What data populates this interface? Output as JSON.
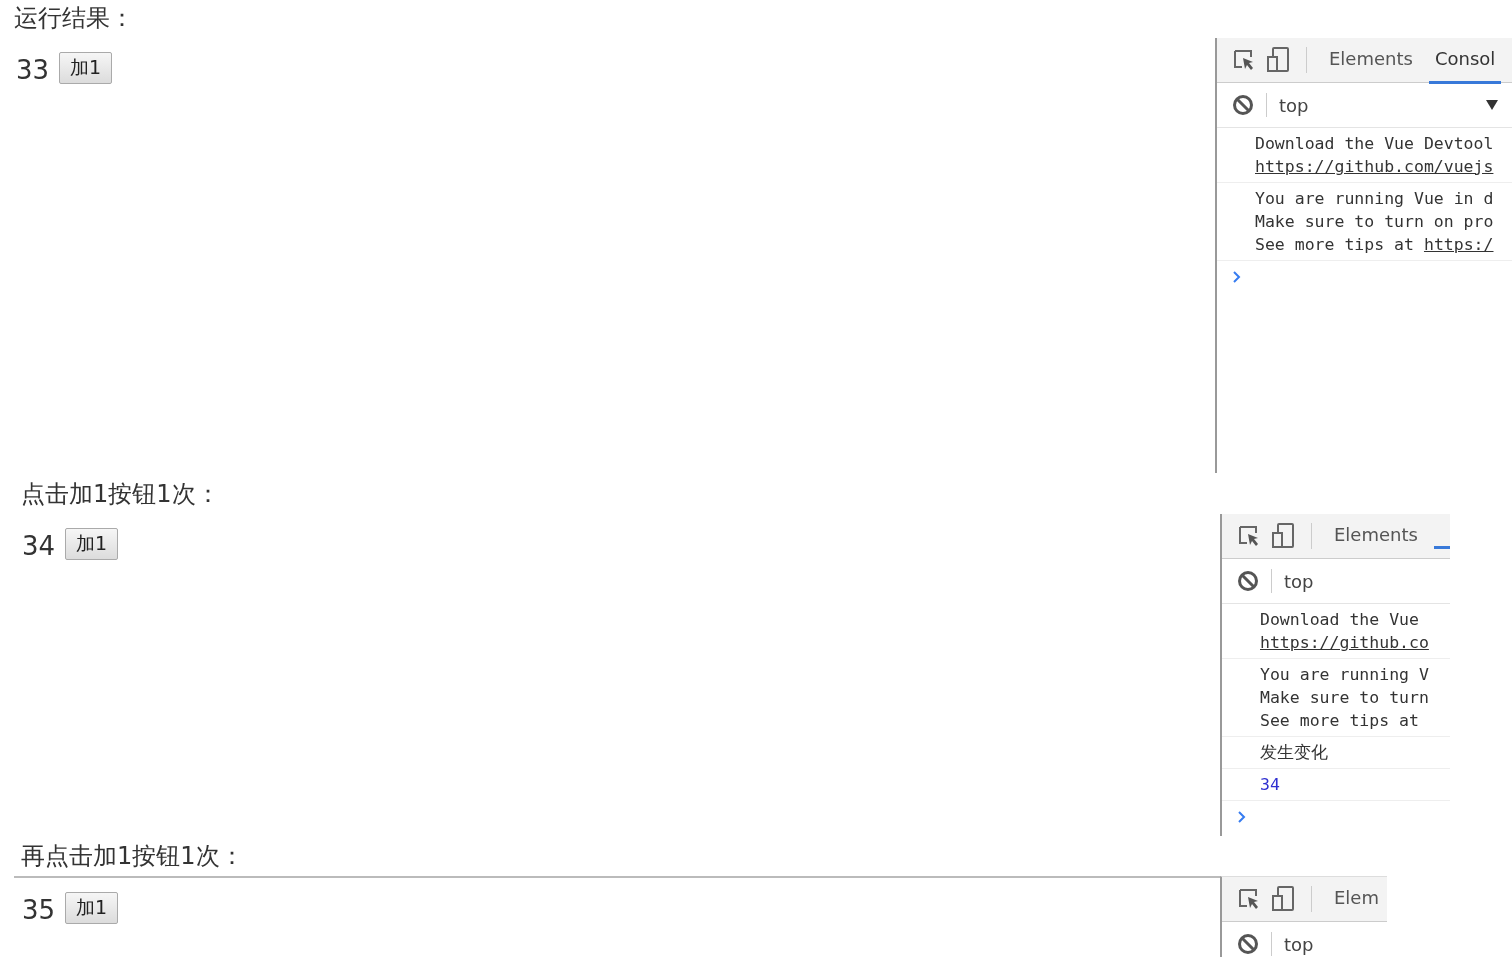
{
  "sections": [
    {
      "caption": "运行结果：",
      "count": "33",
      "button": "加1",
      "devtools": {
        "tabs": [
          {
            "label": "Elements",
            "selected": false
          },
          {
            "label": "Consol",
            "selected": true
          }
        ],
        "context": "top",
        "show_dropdown": true,
        "messages": [
          {
            "kind": "text",
            "lines": [
              {
                "text": "Download the Vue Devtool"
              },
              {
                "link": "https://github.com/vuejs"
              }
            ]
          },
          {
            "kind": "text",
            "lines": [
              {
                "text": "You are running Vue in d"
              },
              {
                "text": "Make sure to turn on pro"
              },
              {
                "text": "See more tips at",
                "link": "https:/"
              }
            ]
          }
        ]
      }
    },
    {
      "caption": "点击加1按钮1次：",
      "count": "34",
      "button": "加1",
      "devtools": {
        "tabs": [
          {
            "label": "Elements",
            "selected": false
          },
          {
            "selected": true
          }
        ],
        "context": "top",
        "show_dropdown": false,
        "messages": [
          {
            "kind": "text",
            "lines": [
              {
                "text": "Download the Vue"
              },
              {
                "link": "https://github.co"
              }
            ]
          },
          {
            "kind": "text",
            "lines": [
              {
                "text": "You are running V"
              },
              {
                "text": "Make sure to turn"
              },
              {
                "text": "See more tips at"
              }
            ]
          },
          {
            "kind": "text",
            "lines": [
              {
                "text": "发生变化"
              }
            ]
          },
          {
            "kind": "number",
            "lines": [
              {
                "text": "34"
              }
            ]
          }
        ]
      }
    },
    {
      "caption": "再点击加1按钮1次：",
      "count": "35",
      "button": "加1",
      "devtools": {
        "tabs": [
          {
            "label": "Elem",
            "selected": false
          }
        ],
        "context": "top",
        "show_dropdown": false
      }
    }
  ]
}
